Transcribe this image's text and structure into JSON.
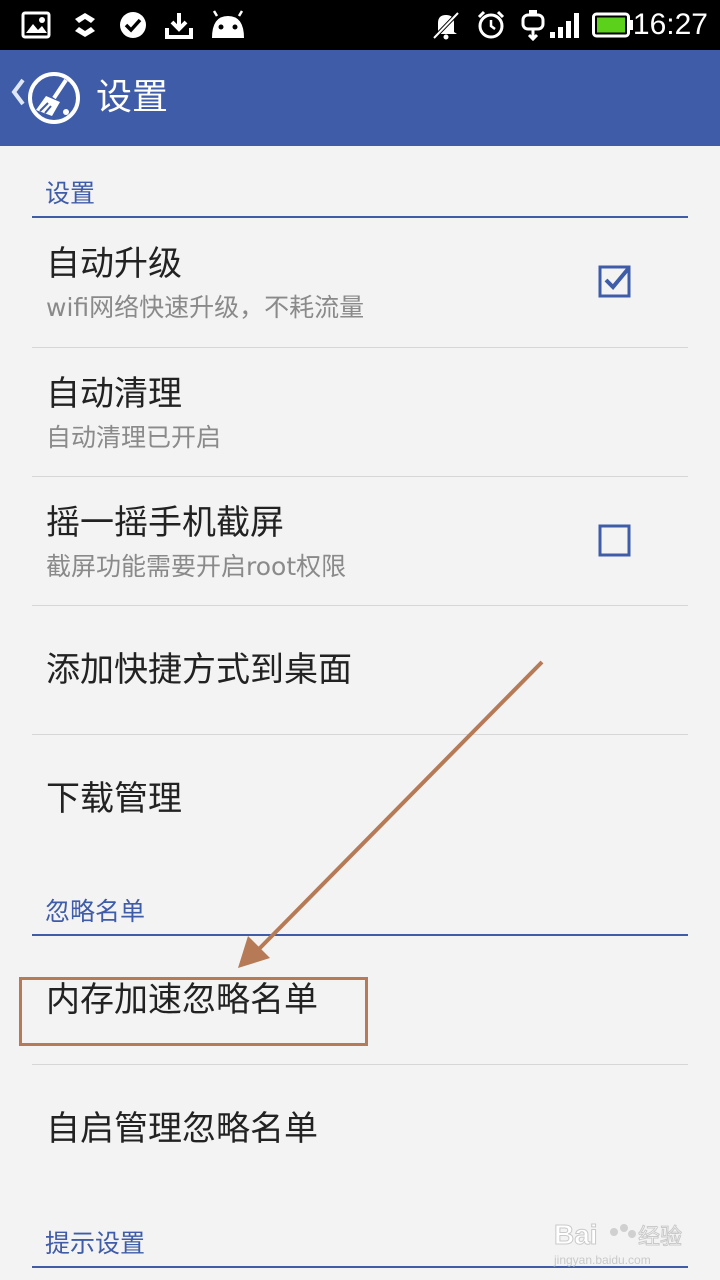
{
  "status_bar": {
    "time": "16:27",
    "left_icons": [
      "gallery-icon",
      "usb-debug-icon",
      "check-circle-icon",
      "download-icon",
      "android-icon"
    ],
    "right_icons": [
      "notifications-muted-icon",
      "alarm-icon",
      "usb-connected-icon",
      "signal-icon",
      "battery-icon"
    ],
    "battery_level": 1.0
  },
  "app_bar": {
    "title": "设置",
    "back_icon": "chevron-left-icon",
    "logo_icon": "broom-icon"
  },
  "sections": {
    "settings": "设置",
    "ignore_list": "忽略名单",
    "tips_settings": "提示设置"
  },
  "items": {
    "auto_upgrade": {
      "title": "自动升级",
      "subtitle": "wifi网络快速升级，不耗流量",
      "checked": true
    },
    "auto_clean": {
      "title": "自动清理",
      "subtitle": "自动清理已开启"
    },
    "shake_screenshot": {
      "title": "摇一摇手机截屏",
      "subtitle": "截屏功能需要开启root权限",
      "checked": false
    },
    "add_shortcut": {
      "title": "添加快捷方式到桌面"
    },
    "download_manager": {
      "title": "下载管理"
    },
    "memory_ignore": {
      "title": "内存加速忽略名单"
    },
    "autostart_ignore": {
      "title": "自启管理忽略名单"
    }
  },
  "annotation": {
    "color": "#b67a56"
  },
  "watermark": {
    "line1": "Baidu经验",
    "line2": "jingyan.baidu.com"
  },
  "colors": {
    "primary": "#3f5ca8",
    "background": "#f3f3f3",
    "annotation": "#b67a56"
  }
}
